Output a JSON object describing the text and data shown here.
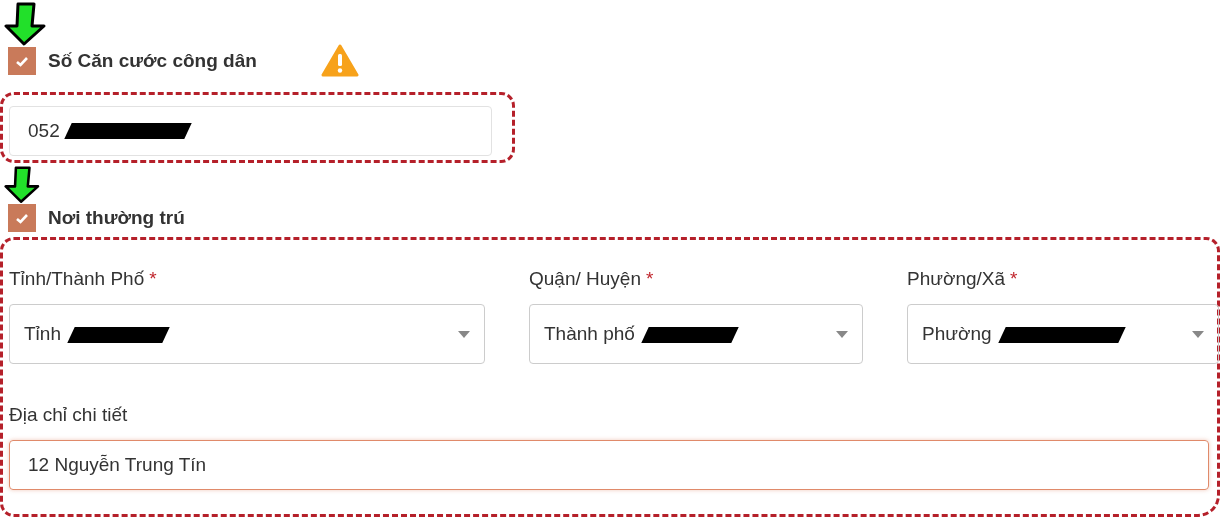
{
  "id_section": {
    "checkbox": {
      "label": "Số Căn cước công dân",
      "checked": true
    },
    "warning": true,
    "field": {
      "value": "052",
      "redacted": true
    }
  },
  "residence_section": {
    "checkbox": {
      "label": "Nơi thường trú",
      "checked": true
    },
    "selects": [
      {
        "label": "Tỉnh/Thành Phố",
        "required_mark": "*",
        "value": "Tỉnh",
        "redacted": true
      },
      {
        "label": "Quận/ Huyện",
        "required_mark": "*",
        "value": "Thành phố",
        "redacted": true
      },
      {
        "label": "Phường/Xã",
        "required_mark": "*",
        "value": "Phường",
        "redacted": true
      }
    ],
    "detail": {
      "label": "Địa chỉ chi tiết",
      "value": "12 Nguyễn Trung Tín",
      "focused": true
    }
  }
}
